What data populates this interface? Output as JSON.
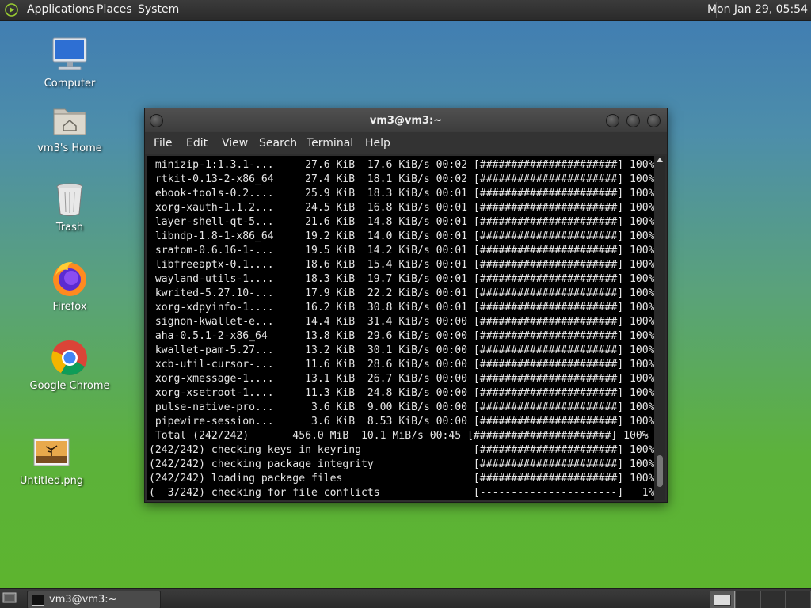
{
  "top_panel": {
    "menus": [
      "Applications",
      "Places",
      "System"
    ],
    "clock": "Mon Jan 29, 05:54"
  },
  "desktop_icons": [
    {
      "label": "Computer",
      "icon": "computer-icon"
    },
    {
      "label": "vm3's Home",
      "icon": "home-folder-icon"
    },
    {
      "label": "Trash",
      "icon": "trash-icon"
    },
    {
      "label": "Firefox",
      "icon": "firefox-icon"
    },
    {
      "label": "Google Chrome",
      "icon": "chrome-icon"
    },
    {
      "label": "Untitled.png",
      "icon": "image-file-icon"
    }
  ],
  "terminal": {
    "title": "vm3@vm3:~",
    "menus": [
      "File",
      "Edit",
      "View",
      "Search",
      "Terminal",
      "Help"
    ],
    "lines": [
      " minizip-1:1.3.1-...     27.6 KiB  17.6 KiB/s 00:02 [######################] 100%",
      " rtkit-0.13-2-x86_64     27.4 KiB  18.1 KiB/s 00:02 [######################] 100%",
      " ebook-tools-0.2....     25.9 KiB  18.3 KiB/s 00:01 [######################] 100%",
      " xorg-xauth-1.1.2...     24.5 KiB  16.8 KiB/s 00:01 [######################] 100%",
      " layer-shell-qt-5...     21.6 KiB  14.8 KiB/s 00:01 [######################] 100%",
      " libndp-1.8-1-x86_64     19.2 KiB  14.0 KiB/s 00:01 [######################] 100%",
      " sratom-0.6.16-1-...     19.5 KiB  14.2 KiB/s 00:01 [######################] 100%",
      " libfreeaptx-0.1....     18.6 KiB  15.4 KiB/s 00:01 [######################] 100%",
      " wayland-utils-1....     18.3 KiB  19.7 KiB/s 00:01 [######################] 100%",
      " kwrited-5.27.10-...     17.9 KiB  22.2 KiB/s 00:01 [######################] 100%",
      " xorg-xdpyinfo-1....     16.2 KiB  30.8 KiB/s 00:01 [######################] 100%",
      " signon-kwallet-e...     14.4 KiB  31.4 KiB/s 00:00 [######################] 100%",
      " aha-0.5.1-2-x86_64      13.8 KiB  29.6 KiB/s 00:00 [######################] 100%",
      " kwallet-pam-5.27...     13.2 KiB  30.1 KiB/s 00:00 [######################] 100%",
      " xcb-util-cursor-...     11.6 KiB  28.6 KiB/s 00:00 [######################] 100%",
      " xorg-xmessage-1....     13.1 KiB  26.7 KiB/s 00:00 [######################] 100%",
      " xorg-xsetroot-1....     11.3 KiB  24.8 KiB/s 00:00 [######################] 100%",
      " pulse-native-pro...      3.6 KiB  9.00 KiB/s 00:00 [######################] 100%",
      " pipewire-session...      3.6 KiB  8.53 KiB/s 00:00 [######################] 100%",
      " Total (242/242)       456.0 MiB  10.1 MiB/s 00:45 [######################] 100%",
      "(242/242) checking keys in keyring                  [######################] 100%",
      "(242/242) checking package integrity                [######################] 100%",
      "(242/242) loading package files                     [######################] 100%",
      "(  3/242) checking for file conflicts               [----------------------]   1%"
    ]
  },
  "taskbar": {
    "task_label": "vm3@vm3:~"
  }
}
